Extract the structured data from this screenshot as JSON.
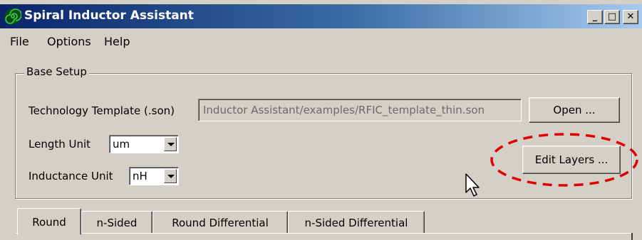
{
  "window": {
    "title": "Spiral Inductor Assistant",
    "icon": "spiral-inductor-icon",
    "controls": {
      "minimize": "_",
      "maximize": "□",
      "close": "✕"
    }
  },
  "menu": {
    "items": [
      "File",
      "Options",
      "Help"
    ]
  },
  "base_setup": {
    "group_title": "Base Setup",
    "technology_template": {
      "label": "Technology Template (.son)",
      "value": "Inductor Assistant/examples/RFIC_template_thin.son"
    },
    "open_button": "Open ...",
    "length_unit": {
      "label": "Length Unit",
      "value": "um"
    },
    "inductance_unit": {
      "label": "Inductance Unit",
      "value": "nH"
    },
    "edit_layers_button": "Edit Layers ..."
  },
  "tabs": [
    {
      "label": "Round",
      "active": true
    },
    {
      "label": "n-Sided",
      "active": false
    },
    {
      "label": "Round Differential",
      "active": false
    },
    {
      "label": "n-Sided Differential",
      "active": false
    }
  ],
  "colors": {
    "titlebar_start": "#0a246a",
    "titlebar_end": "#a6caf0",
    "window_bg": "#d4d0c8",
    "annotation": "#e00000"
  },
  "annotation": {
    "shape": "dashed-ellipse",
    "target": "edit-layers-button"
  }
}
